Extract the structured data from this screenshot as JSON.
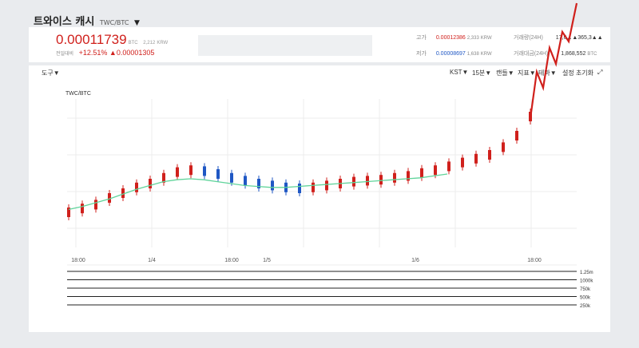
{
  "header": {
    "name": "트와이스 캐시",
    "pair": "TWC/BTC",
    "caret": "▼"
  },
  "ticker": {
    "price": "0.00011739",
    "price_unit": "BTC",
    "price_krw": "2,212",
    "price_krw_unit": "KRW",
    "change_label": "전일대비",
    "change_pct": "+12.51%",
    "change_arrow": "▲",
    "change_abs": "0.00001305"
  },
  "stats": {
    "high_label": "고가",
    "high": "0.00012386",
    "high_krw": "2,333",
    "high_krw_unit": "KRW",
    "low_label": "저가",
    "low": "0.00008697",
    "low_krw": "1,638",
    "low_krw_unit": "KRW",
    "vol_label": "거래량(24H)",
    "vol": "17,6▲▲365,3▲▲",
    "amt_label": "거래대금(24H)",
    "amt": "1,868,552",
    "amt_unit": "BTC"
  },
  "toolbar": {
    "tools": "도구▼",
    "tz": "KST▼",
    "interval": "15분▼",
    "candle": "캔들▼",
    "indicator": "지표▼",
    "theme": "테마▼",
    "settings": "설정 초기화",
    "expand": "⤢"
  },
  "chart_title": "TWC/BTC",
  "chart_data": {
    "type": "line",
    "x_tick_labels": [
      "18:00",
      "1/4",
      "18:00",
      "1/5",
      "1/6",
      "18:00"
    ],
    "volume_axis": [
      "1.25m",
      "1000k",
      "750k",
      "500k",
      "250k"
    ],
    "price_series": [
      0.3,
      0.34,
      0.38,
      0.45,
      0.5,
      0.56,
      0.6,
      0.66,
      0.72,
      0.74,
      0.73,
      0.7,
      0.66,
      0.63,
      0.6,
      0.58,
      0.56,
      0.55,
      0.56,
      0.58,
      0.6,
      0.62,
      0.63,
      0.64,
      0.66,
      0.68,
      0.71,
      0.74,
      0.78,
      0.82,
      0.86,
      0.9,
      0.98,
      1.1,
      1.3
    ],
    "ma_series": [
      0.33,
      0.36,
      0.4,
      0.44,
      0.49,
      0.54,
      0.58,
      0.62,
      0.64,
      0.65,
      0.64,
      0.62,
      0.6,
      0.58,
      0.57,
      0.56,
      0.56,
      0.57,
      0.58,
      0.59,
      0.6,
      0.61,
      0.62,
      0.63,
      0.64,
      0.65,
      0.66,
      0.68,
      0.7
    ]
  },
  "colors": {
    "up": "#d0201c",
    "down": "#1f57c4",
    "ma": "#5fd49a"
  }
}
